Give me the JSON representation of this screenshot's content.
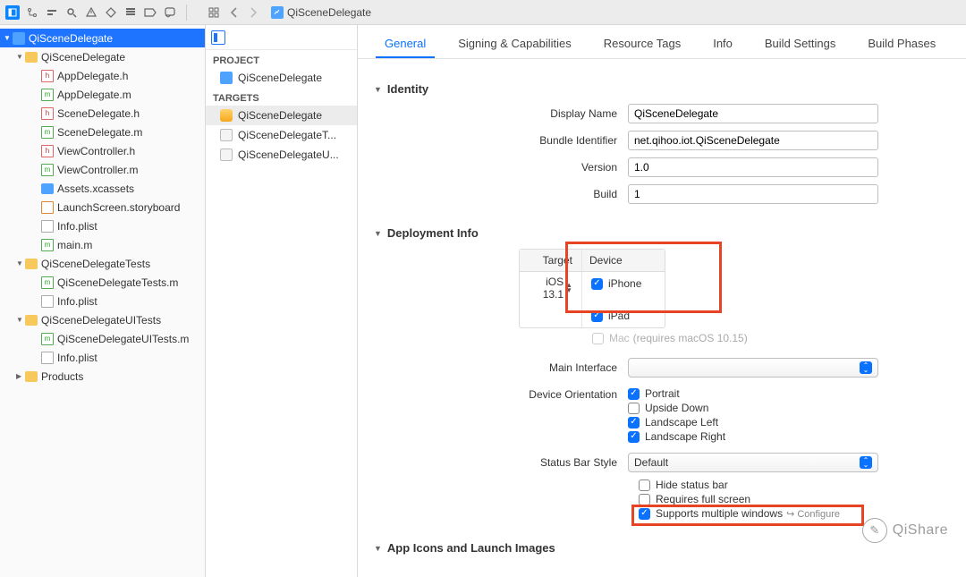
{
  "breadcrumb": {
    "title": "QiSceneDelegate"
  },
  "sidebar": {
    "root": "QiSceneDelegate",
    "group1": {
      "name": "QiSceneDelegate",
      "files": [
        {
          "n": "AppDelegate.h",
          "k": "h"
        },
        {
          "n": "AppDelegate.m",
          "k": "m"
        },
        {
          "n": "SceneDelegate.h",
          "k": "h"
        },
        {
          "n": "SceneDelegate.m",
          "k": "m"
        },
        {
          "n": "ViewController.h",
          "k": "h"
        },
        {
          "n": "ViewController.m",
          "k": "m"
        },
        {
          "n": "Assets.xcassets",
          "k": "asset"
        },
        {
          "n": "LaunchScreen.storyboard",
          "k": "story"
        },
        {
          "n": "Info.plist",
          "k": "plist"
        },
        {
          "n": "main.m",
          "k": "m"
        }
      ]
    },
    "group2": {
      "name": "QiSceneDelegateTests",
      "files": [
        {
          "n": "QiSceneDelegateTests.m",
          "k": "m"
        },
        {
          "n": "Info.plist",
          "k": "plist"
        }
      ]
    },
    "group3": {
      "name": "QiSceneDelegateUITests",
      "files": [
        {
          "n": "QiSceneDelegateUITests.m",
          "k": "m"
        },
        {
          "n": "Info.plist",
          "k": "plist"
        }
      ]
    },
    "products": "Products"
  },
  "targets": {
    "project_hdr": "PROJECT",
    "project": "QiSceneDelegate",
    "targets_hdr": "TARGETS",
    "list": [
      {
        "n": "QiSceneDelegate",
        "sel": true,
        "k": "app"
      },
      {
        "n": "QiSceneDelegateT...",
        "sel": false,
        "k": "test"
      },
      {
        "n": "QiSceneDelegateU...",
        "sel": false,
        "k": "test"
      }
    ]
  },
  "tabs": [
    "General",
    "Signing & Capabilities",
    "Resource Tags",
    "Info",
    "Build Settings",
    "Build Phases"
  ],
  "active_tab": 0,
  "sections": {
    "identity": "Identity",
    "deployment": "Deployment Info",
    "appicons": "App Icons and Launch Images"
  },
  "identity": {
    "display_name_l": "Display Name",
    "display_name": "QiSceneDelegate",
    "bundle_id_l": "Bundle Identifier",
    "bundle_id": "net.qihoo.iot.QiSceneDelegate",
    "version_l": "Version",
    "version": "1.0",
    "build_l": "Build",
    "build": "1"
  },
  "deployment": {
    "th_target": "Target",
    "th_device": "Device",
    "target": "iOS 13.1",
    "devices": {
      "iphone": "iPhone",
      "ipad": "iPad",
      "mac": "Mac",
      "mac_req": "(requires macOS 10.15)"
    },
    "main_interface_l": "Main Interface",
    "orientation_l": "Device Orientation",
    "orientations": {
      "portrait": "Portrait",
      "upside": "Upside Down",
      "ll": "Landscape Left",
      "lr": "Landscape Right"
    },
    "status_l": "Status Bar Style",
    "status_v": "Default",
    "hide_status": "Hide status bar",
    "fullscreen": "Requires full screen",
    "multi": "Supports multiple windows",
    "configure": "Configure"
  },
  "watermark": "QiShare"
}
